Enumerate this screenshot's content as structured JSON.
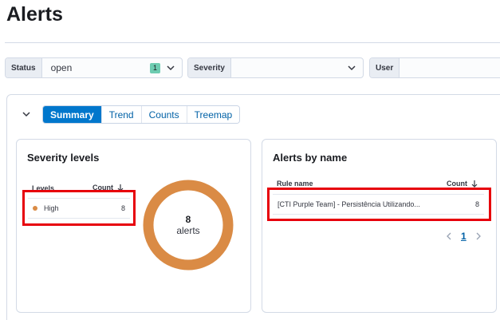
{
  "page": {
    "title": "Alerts"
  },
  "filters": [
    {
      "label": "Status",
      "value": "open",
      "badge": "1"
    },
    {
      "label": "Severity",
      "value": ""
    },
    {
      "label": "User",
      "value": ""
    }
  ],
  "tabs": [
    {
      "label": "Summary",
      "active": true
    },
    {
      "label": "Trend",
      "active": false
    },
    {
      "label": "Counts",
      "active": false
    },
    {
      "label": "Treemap",
      "active": false
    }
  ],
  "severity_card": {
    "title": "Severity levels",
    "col_levels": "Levels",
    "col_count": "Count",
    "rows": [
      {
        "level": "High",
        "count": "8",
        "color": "#da8b45"
      }
    ],
    "donut": {
      "total": "8",
      "label": "alerts",
      "color": "#da8b45"
    }
  },
  "alerts_card": {
    "title": "Alerts by name",
    "col_rule": "Rule name",
    "col_count": "Count",
    "rows": [
      {
        "rule": "[CTI Purple Team] - Persistência Utilizando...",
        "count": "8"
      }
    ],
    "pagination": {
      "current": "1"
    }
  },
  "icons": {
    "dropdown": "chevron-down-icon",
    "collapse": "chevron-down-icon",
    "sort": "arrow-down-icon",
    "prev": "chevron-left-icon",
    "next": "chevron-right-icon"
  },
  "colors": {
    "accent": "#0077cc",
    "high": "#da8b45",
    "highlight": "#e7000b",
    "badge": "#6dccb1"
  }
}
